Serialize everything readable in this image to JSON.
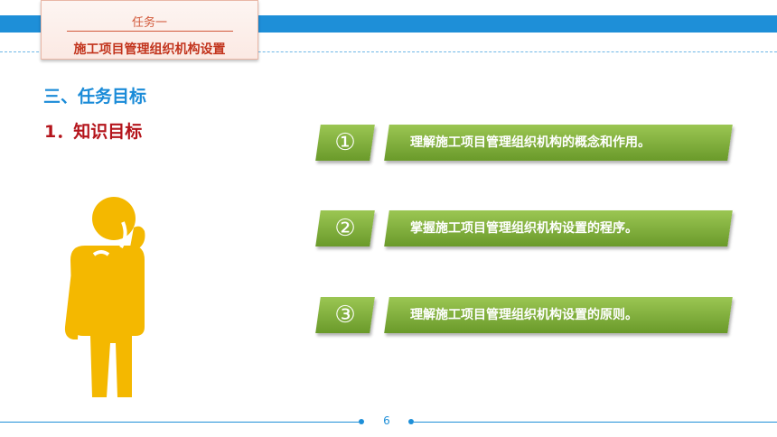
{
  "header": {
    "task_label": "任务一",
    "task_title": "施工项目管理组织机构设置"
  },
  "section_heading": "三、任务目标",
  "sub_heading": "1．知识目标",
  "items": [
    {
      "number": "①",
      "text": "理解施工项目管理组织机构的概念和作用。"
    },
    {
      "number": "②",
      "text": "掌握施工项目管理组织机构设置的程序。"
    },
    {
      "number": "③",
      "text": "理解施工项目管理组织机构设置的原则。"
    }
  ],
  "footer": {
    "page_number": "6"
  },
  "colors": {
    "accent_blue": "#1e8fd8",
    "item_green": "#8cb847",
    "heading_red": "#b4141b",
    "figure_yellow": "#f4b800"
  },
  "icons": {
    "figure": "thinking-person-icon"
  }
}
